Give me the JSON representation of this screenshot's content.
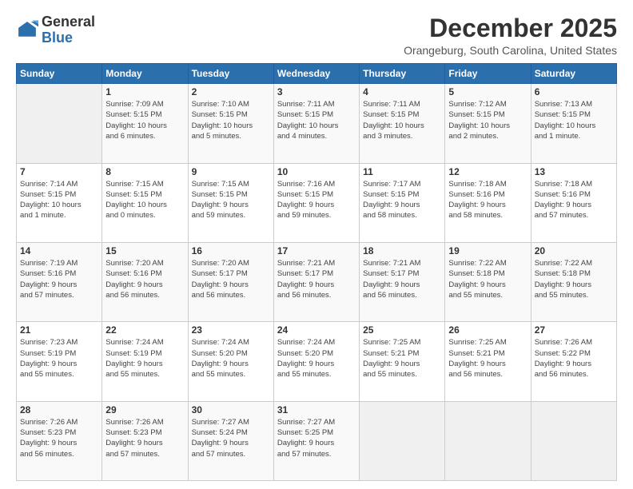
{
  "header": {
    "logo_general": "General",
    "logo_blue": "Blue",
    "title": "December 2025",
    "subtitle": "Orangeburg, South Carolina, United States"
  },
  "calendar": {
    "days_of_week": [
      "Sunday",
      "Monday",
      "Tuesday",
      "Wednesday",
      "Thursday",
      "Friday",
      "Saturday"
    ],
    "weeks": [
      [
        {
          "day": "",
          "info": ""
        },
        {
          "day": "1",
          "info": "Sunrise: 7:09 AM\nSunset: 5:15 PM\nDaylight: 10 hours\nand 6 minutes."
        },
        {
          "day": "2",
          "info": "Sunrise: 7:10 AM\nSunset: 5:15 PM\nDaylight: 10 hours\nand 5 minutes."
        },
        {
          "day": "3",
          "info": "Sunrise: 7:11 AM\nSunset: 5:15 PM\nDaylight: 10 hours\nand 4 minutes."
        },
        {
          "day": "4",
          "info": "Sunrise: 7:11 AM\nSunset: 5:15 PM\nDaylight: 10 hours\nand 3 minutes."
        },
        {
          "day": "5",
          "info": "Sunrise: 7:12 AM\nSunset: 5:15 PM\nDaylight: 10 hours\nand 2 minutes."
        },
        {
          "day": "6",
          "info": "Sunrise: 7:13 AM\nSunset: 5:15 PM\nDaylight: 10 hours\nand 1 minute."
        }
      ],
      [
        {
          "day": "7",
          "info": "Sunrise: 7:14 AM\nSunset: 5:15 PM\nDaylight: 10 hours\nand 1 minute."
        },
        {
          "day": "8",
          "info": "Sunrise: 7:15 AM\nSunset: 5:15 PM\nDaylight: 10 hours\nand 0 minutes."
        },
        {
          "day": "9",
          "info": "Sunrise: 7:15 AM\nSunset: 5:15 PM\nDaylight: 9 hours\nand 59 minutes."
        },
        {
          "day": "10",
          "info": "Sunrise: 7:16 AM\nSunset: 5:15 PM\nDaylight: 9 hours\nand 59 minutes."
        },
        {
          "day": "11",
          "info": "Sunrise: 7:17 AM\nSunset: 5:15 PM\nDaylight: 9 hours\nand 58 minutes."
        },
        {
          "day": "12",
          "info": "Sunrise: 7:18 AM\nSunset: 5:16 PM\nDaylight: 9 hours\nand 58 minutes."
        },
        {
          "day": "13",
          "info": "Sunrise: 7:18 AM\nSunset: 5:16 PM\nDaylight: 9 hours\nand 57 minutes."
        }
      ],
      [
        {
          "day": "14",
          "info": "Sunrise: 7:19 AM\nSunset: 5:16 PM\nDaylight: 9 hours\nand 57 minutes."
        },
        {
          "day": "15",
          "info": "Sunrise: 7:20 AM\nSunset: 5:16 PM\nDaylight: 9 hours\nand 56 minutes."
        },
        {
          "day": "16",
          "info": "Sunrise: 7:20 AM\nSunset: 5:17 PM\nDaylight: 9 hours\nand 56 minutes."
        },
        {
          "day": "17",
          "info": "Sunrise: 7:21 AM\nSunset: 5:17 PM\nDaylight: 9 hours\nand 56 minutes."
        },
        {
          "day": "18",
          "info": "Sunrise: 7:21 AM\nSunset: 5:17 PM\nDaylight: 9 hours\nand 56 minutes."
        },
        {
          "day": "19",
          "info": "Sunrise: 7:22 AM\nSunset: 5:18 PM\nDaylight: 9 hours\nand 55 minutes."
        },
        {
          "day": "20",
          "info": "Sunrise: 7:22 AM\nSunset: 5:18 PM\nDaylight: 9 hours\nand 55 minutes."
        }
      ],
      [
        {
          "day": "21",
          "info": "Sunrise: 7:23 AM\nSunset: 5:19 PM\nDaylight: 9 hours\nand 55 minutes."
        },
        {
          "day": "22",
          "info": "Sunrise: 7:24 AM\nSunset: 5:19 PM\nDaylight: 9 hours\nand 55 minutes."
        },
        {
          "day": "23",
          "info": "Sunrise: 7:24 AM\nSunset: 5:20 PM\nDaylight: 9 hours\nand 55 minutes."
        },
        {
          "day": "24",
          "info": "Sunrise: 7:24 AM\nSunset: 5:20 PM\nDaylight: 9 hours\nand 55 minutes."
        },
        {
          "day": "25",
          "info": "Sunrise: 7:25 AM\nSunset: 5:21 PM\nDaylight: 9 hours\nand 55 minutes."
        },
        {
          "day": "26",
          "info": "Sunrise: 7:25 AM\nSunset: 5:21 PM\nDaylight: 9 hours\nand 56 minutes."
        },
        {
          "day": "27",
          "info": "Sunrise: 7:26 AM\nSunset: 5:22 PM\nDaylight: 9 hours\nand 56 minutes."
        }
      ],
      [
        {
          "day": "28",
          "info": "Sunrise: 7:26 AM\nSunset: 5:23 PM\nDaylight: 9 hours\nand 56 minutes."
        },
        {
          "day": "29",
          "info": "Sunrise: 7:26 AM\nSunset: 5:23 PM\nDaylight: 9 hours\nand 57 minutes."
        },
        {
          "day": "30",
          "info": "Sunrise: 7:27 AM\nSunset: 5:24 PM\nDaylight: 9 hours\nand 57 minutes."
        },
        {
          "day": "31",
          "info": "Sunrise: 7:27 AM\nSunset: 5:25 PM\nDaylight: 9 hours\nand 57 minutes."
        },
        {
          "day": "",
          "info": ""
        },
        {
          "day": "",
          "info": ""
        },
        {
          "day": "",
          "info": ""
        }
      ]
    ]
  }
}
